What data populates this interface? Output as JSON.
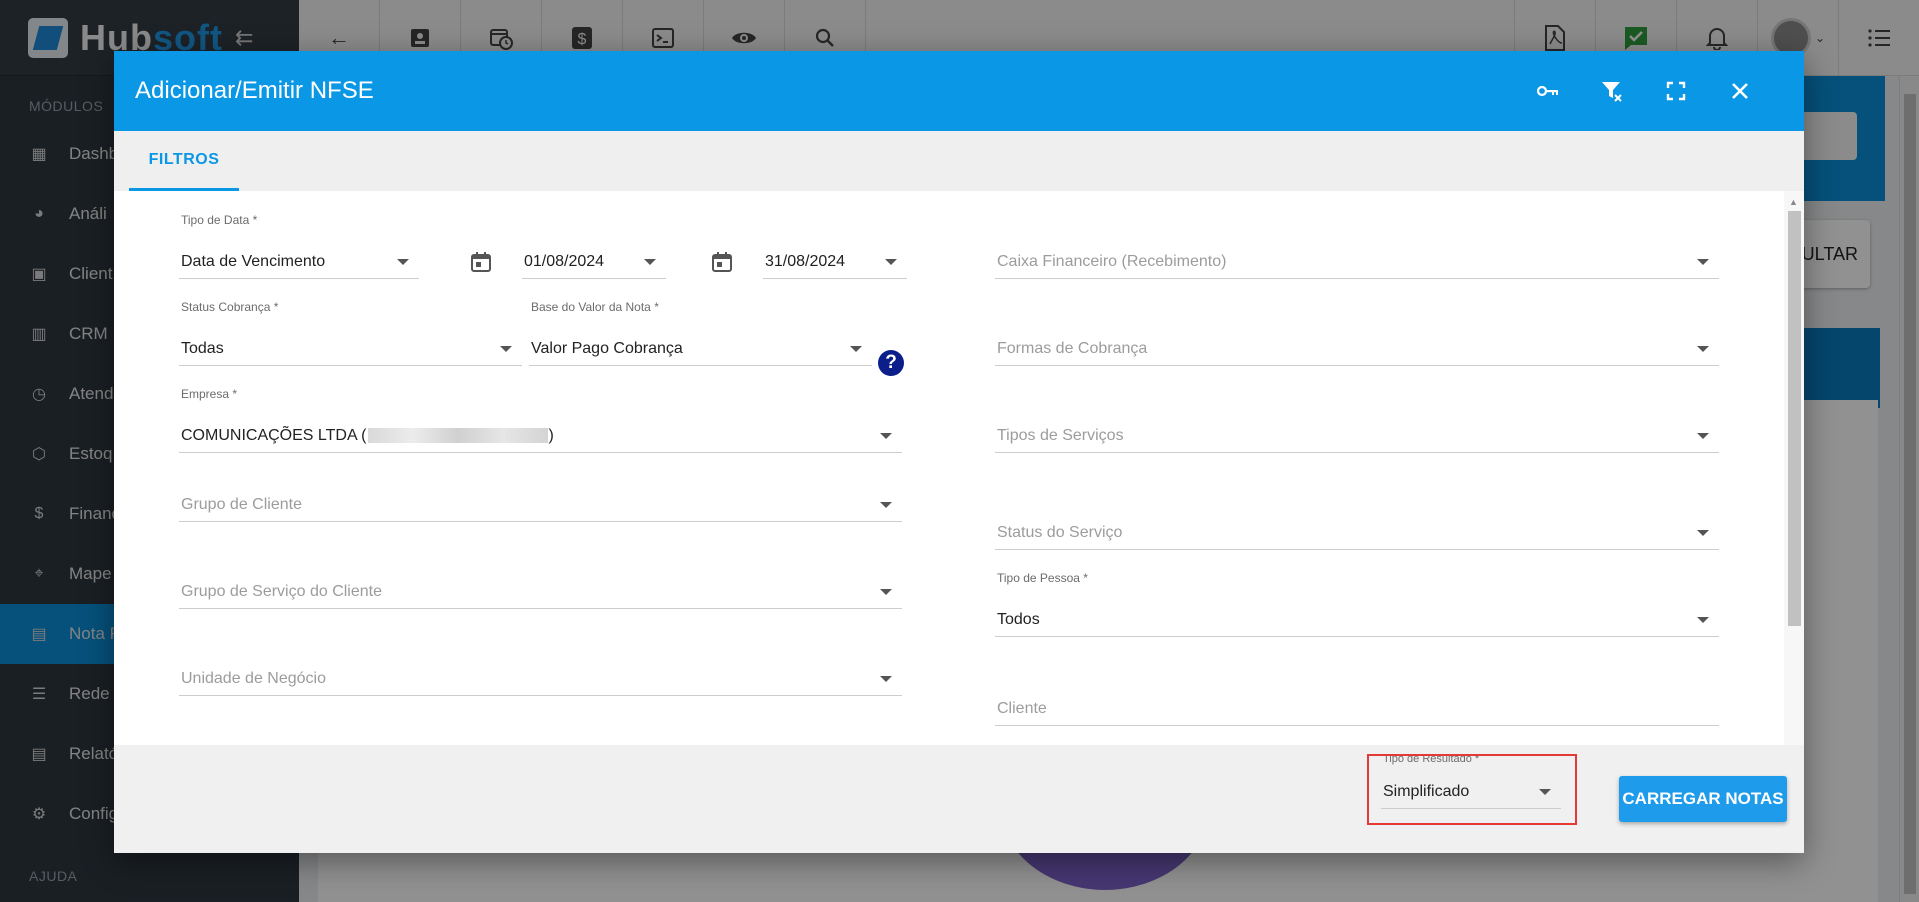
{
  "app": {
    "logo_prefix": "Hub",
    "logo_suffix": "soft"
  },
  "sidebar": {
    "section_label": "MÓDULOS",
    "help_label": "AJUDA",
    "items": [
      {
        "label": "Dashb",
        "icon": "dashboard-icon"
      },
      {
        "label": "Análi",
        "icon": "pie-chart-icon"
      },
      {
        "label": "Client",
        "icon": "contact-card-icon"
      },
      {
        "label": "CRM",
        "icon": "kanban-icon"
      },
      {
        "label": "Atendi",
        "icon": "calendar-clock-icon"
      },
      {
        "label": "Estoq",
        "icon": "box-icon"
      },
      {
        "label": "Financ",
        "icon": "money-icon"
      },
      {
        "label": "Mape",
        "icon": "map-pin-icon"
      },
      {
        "label": "Nota F",
        "icon": "document-icon"
      },
      {
        "label": "Rede",
        "icon": "server-icon"
      },
      {
        "label": "Relató",
        "icon": "report-icon"
      },
      {
        "label": "Config",
        "icon": "gear-icon"
      }
    ]
  },
  "background": {
    "consultar_label": "SULTAR"
  },
  "dialog": {
    "title": "Adicionar/Emitir NFSE",
    "tab": "FILTROS",
    "fields": {
      "tipo_data": {
        "label": "Tipo de Data *",
        "value": "Data de Vencimento"
      },
      "date_start": {
        "value": "01/08/2024"
      },
      "date_end": {
        "value": "31/08/2024"
      },
      "caixa": {
        "placeholder": "Caixa Financeiro (Recebimento)"
      },
      "status_cobranca": {
        "label": "Status Cobrança *",
        "value": "Todas"
      },
      "base_valor": {
        "label": "Base do Valor da Nota *",
        "value": "Valor Pago Cobrança"
      },
      "formas": {
        "placeholder": "Formas de Cobrança"
      },
      "empresa": {
        "label": "Empresa *",
        "value_prefix": "COMUNICAÇÕES LTDA (",
        "value_suffix": ")"
      },
      "tipos_servicos": {
        "placeholder": "Tipos de Serviços"
      },
      "grupo_cliente": {
        "placeholder": "Grupo de Cliente"
      },
      "status_servico": {
        "placeholder": "Status do Serviço"
      },
      "grupo_servico": {
        "placeholder": "Grupo de Serviço do Cliente"
      },
      "tipo_pessoa": {
        "label": "Tipo de Pessoa *",
        "value": "Todos"
      },
      "unidade": {
        "placeholder": "Unidade de Negócio"
      },
      "cliente": {
        "placeholder": "Cliente"
      }
    },
    "footer": {
      "result_label": "Tipo de Resultado *",
      "result_value": "Simplificado",
      "load_button": "CARREGAR NOTAS"
    },
    "help_glyph": "?"
  }
}
